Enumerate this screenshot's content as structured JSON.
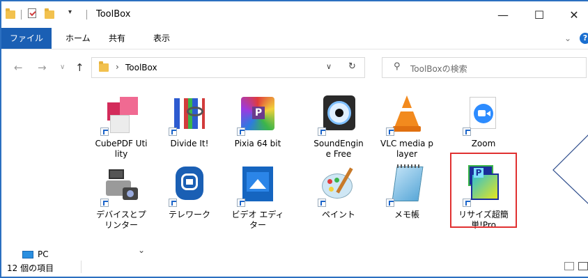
{
  "window": {
    "title": "ToolBox",
    "minimize": "—",
    "maximize": "☐",
    "close": "✕"
  },
  "ribbon": {
    "tabs": [
      "ファイル",
      "ホーム",
      "共有",
      "表示"
    ],
    "help": "?"
  },
  "address": {
    "path": "ToolBox",
    "search_placeholder": "ToolBoxの検索"
  },
  "items": [
    {
      "label": "CubePDF Utility",
      "icon": "cubepdf-icon"
    },
    {
      "label": "Divide It!",
      "icon": "divide-it-icon"
    },
    {
      "label": "Pixia 64 bit",
      "icon": "pixia-icon"
    },
    {
      "label": "SoundEngine Free",
      "icon": "soundengine-icon"
    },
    {
      "label": "VLC media player",
      "icon": "vlc-icon"
    },
    {
      "label": "Zoom",
      "icon": "zoom-icon"
    },
    {
      "label": "デバイスとプリンター",
      "icon": "devices-printers-icon"
    },
    {
      "label": "テレワーク",
      "icon": "telework-icon"
    },
    {
      "label": "ビデオ エディター",
      "icon": "video-editor-icon"
    },
    {
      "label": "ペイント",
      "icon": "paint-icon"
    },
    {
      "label": "メモ帳",
      "icon": "notepad-icon"
    },
    {
      "label": "リサイズ超簡単!Pro",
      "icon": "resize-pro-icon"
    }
  ],
  "navpane": {
    "pc": "PC"
  },
  "status": {
    "count": "12 個の項目"
  },
  "colors": {
    "accent": "#1a5fb4",
    "highlight": "#e03030",
    "border": "#2b6fc0"
  }
}
